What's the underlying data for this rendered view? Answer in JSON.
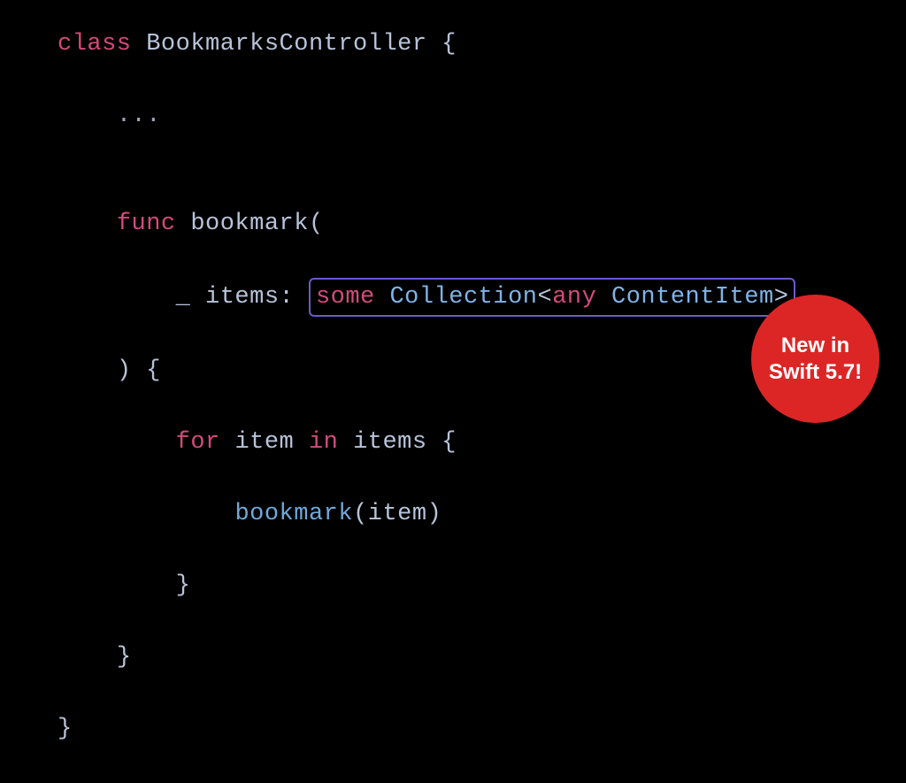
{
  "code": {
    "kw_class": "class",
    "class_name": "BookmarksController",
    "brace_open": "{",
    "ellipsis": "...",
    "kw_func": "func",
    "func_name": "bookmark",
    "paren_open": "(",
    "param_prefix": "_ items: ",
    "kw_some": "some",
    "type_collection": "Collection",
    "angle_open": "<",
    "kw_any": "any",
    "type_contentitem": "ContentItem",
    "angle_close": ">",
    "paren_close_brace": ") {",
    "kw_for": "for",
    "item_name": "item",
    "kw_in": "in",
    "items_name": "items",
    "brace_open2": "{",
    "call_bookmark": "bookmark",
    "call_args": "(item)",
    "brace_close1": "}",
    "brace_close2": "}",
    "brace_close3": "}"
  },
  "badge": {
    "line1": "New in",
    "line2": "Swift 5.7!"
  }
}
